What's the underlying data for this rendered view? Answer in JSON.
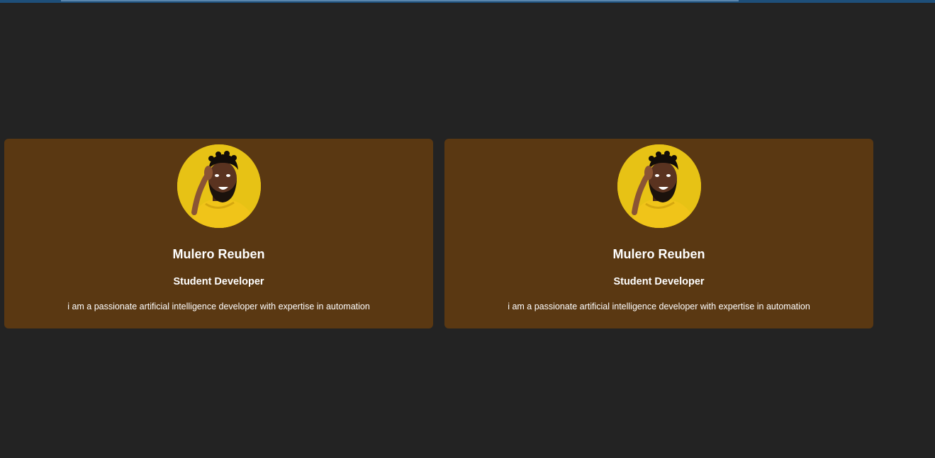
{
  "colors": {
    "page_background": "#232323",
    "card_background": "#5a3812",
    "text": "#ffffff",
    "avatar_background": "#e7c215",
    "top_bar": "#1e4f7a"
  },
  "cards": [
    {
      "avatar_icon": "person-portrait",
      "name": "Mulero Reuben",
      "role": "Student Developer",
      "bio": "i am a passionate artificial intelligence developer with expertise in automation"
    },
    {
      "avatar_icon": "person-portrait",
      "name": "Mulero Reuben",
      "role": "Student Developer",
      "bio": "i am a passionate artificial intelligence developer with expertise in automation"
    }
  ]
}
